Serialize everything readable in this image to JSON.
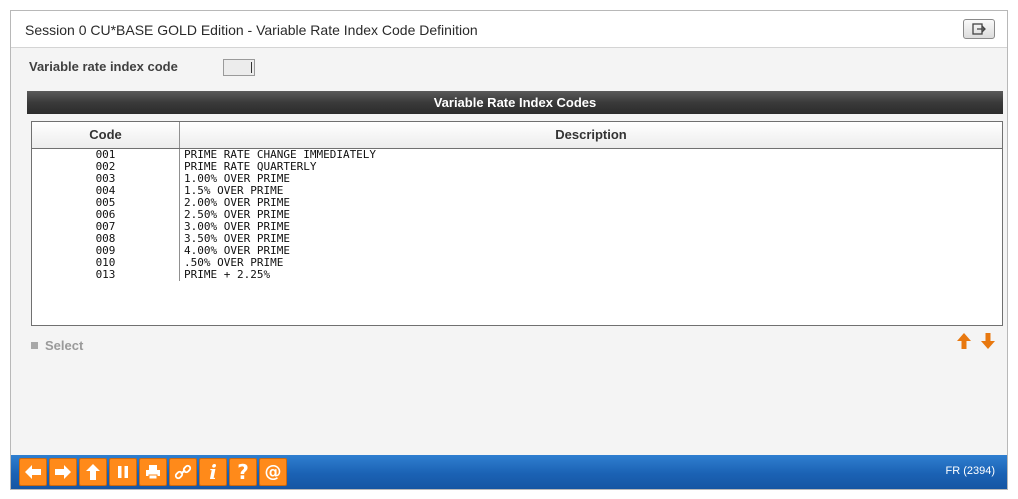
{
  "window": {
    "title": "Session 0 CU*BASE GOLD Edition - Variable Rate Index Code Definition"
  },
  "form": {
    "index_code_label": "Variable rate index code",
    "index_code_value": ""
  },
  "panel": {
    "title": "Variable Rate Index Codes"
  },
  "table": {
    "columns": [
      "Code",
      "Description"
    ],
    "rows": [
      {
        "code": "001",
        "description": "PRIME RATE CHANGE IMMEDIATELY"
      },
      {
        "code": "002",
        "description": "PRIME RATE QUARTERLY"
      },
      {
        "code": "003",
        "description": "1.00% OVER PRIME"
      },
      {
        "code": "004",
        "description": "1.5% OVER PRIME"
      },
      {
        "code": "005",
        "description": "2.00% OVER PRIME"
      },
      {
        "code": "006",
        "description": "2.50% OVER PRIME"
      },
      {
        "code": "007",
        "description": "3.00% OVER PRIME"
      },
      {
        "code": "008",
        "description": "3.50% OVER PRIME"
      },
      {
        "code": "009",
        "description": "4.00% OVER PRIME"
      },
      {
        "code": "010",
        "description": ".50% OVER PRIME"
      },
      {
        "code": "013",
        "description": "PRIME + 2.25%"
      }
    ]
  },
  "actions": {
    "select_label": "Select"
  },
  "footer": {
    "buttons": [
      "back-arrow-icon",
      "forward-arrow-icon",
      "up-arrow-icon",
      "pause-icon",
      "print-icon",
      "link-icon",
      "info-icon",
      "help-icon",
      "at-icon"
    ],
    "screen_code": "FR (2394)"
  },
  "colors": {
    "footer_blue": "#1b62b4",
    "button_orange": "#ff8a1a",
    "header_dark": "#3a3a3a",
    "arrow_orange": "#e8780f"
  }
}
